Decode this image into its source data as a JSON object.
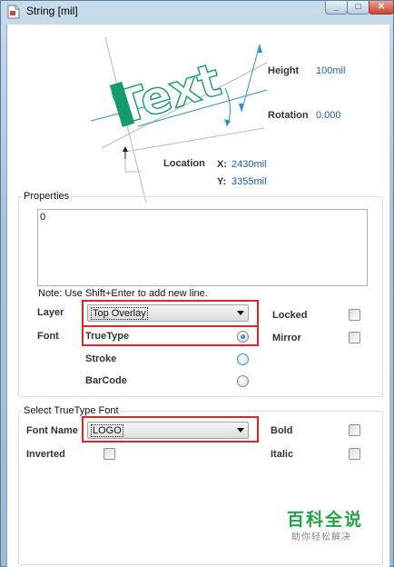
{
  "window": {
    "title": "String  [mil]"
  },
  "preview": {
    "sample_text": "Text",
    "height_label": "Height",
    "height_value": "100mil",
    "rotation_label": "Rotation",
    "rotation_value": "0.000",
    "location_label": "Location",
    "x_label": "X:",
    "x_value": "2430mil",
    "y_label": "Y:",
    "y_value": "3355mil",
    "accent_color": "#169b6b",
    "guide_color": "#2f8ed0"
  },
  "properties": {
    "group_title": "Properties",
    "text_value": "0",
    "note": "Note: Use Shift+Enter to add new line.",
    "layer_label": "Layer",
    "layer_value": "Top Overlay",
    "font_label": "Font",
    "font_options": [
      {
        "label": "TrueType",
        "selected": true
      },
      {
        "label": "Stroke",
        "selected": false
      },
      {
        "label": "BarCode",
        "selected": false
      }
    ],
    "locked_label": "Locked",
    "locked_checked": false,
    "mirror_label": "Mirror",
    "mirror_checked": false
  },
  "truetype": {
    "group_title": "Select TrueType Font",
    "font_name_label": "Font Name",
    "font_name_value": "LOGO",
    "inverted_label": "Inverted",
    "inverted_checked": false,
    "bold_label": "Bold",
    "bold_checked": false,
    "italic_label": "Italic",
    "italic_checked": false
  },
  "watermark": {
    "main": "百科全说",
    "sub": "助你轻松解决"
  },
  "colors": {
    "highlight": "#e0252b"
  }
}
